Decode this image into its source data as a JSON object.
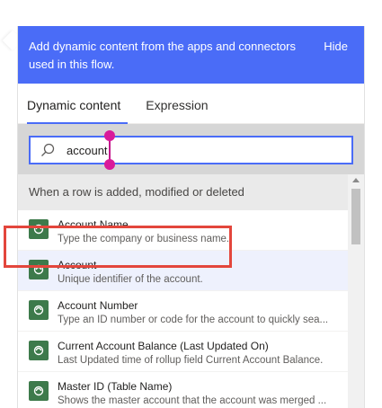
{
  "banner": {
    "text": "Add dynamic content from the apps and connectors used in this flow.",
    "hide_label": "Hide"
  },
  "tabs": [
    {
      "label": "Dynamic content",
      "active": true
    },
    {
      "label": "Expression",
      "active": false
    }
  ],
  "search": {
    "value": "account",
    "icon": "search-icon"
  },
  "section": {
    "header": "When a row is added, modified or deleted"
  },
  "items": [
    {
      "title": "Account Name",
      "desc": "Type the company or business name.",
      "icon": "dataverse-icon"
    },
    {
      "title": "Account",
      "desc": "Unique identifier of the account.",
      "icon": "dataverse-icon"
    },
    {
      "title": "Account Number",
      "desc": "Type an ID number or code for the account to quickly sea...",
      "icon": "dataverse-icon"
    },
    {
      "title": "Current Account Balance (Last Updated On)",
      "desc": "Last Updated time of rollup field Current Account Balance.",
      "icon": "dataverse-icon"
    },
    {
      "title": "Master ID (Table Name)",
      "desc": "Shows the master account that the account was merged ...",
      "icon": "dataverse-icon"
    }
  ],
  "colors": {
    "accent": "#4a6cf7",
    "highlight": "#e3463c",
    "icon_bg": "#3d7a4b"
  }
}
